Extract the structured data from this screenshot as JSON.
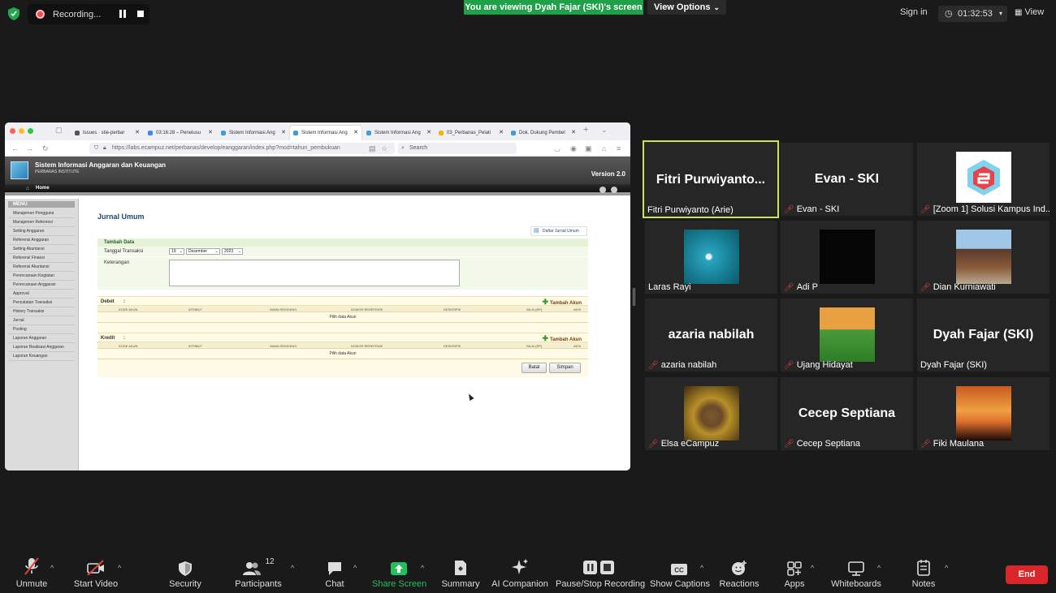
{
  "topbar": {
    "recording_label": "Recording...",
    "banner": "You are viewing Dyah Fajar (SKI)'s screen",
    "view_options": "View Options",
    "sign_in": "Sign in",
    "timer": "01:32:53",
    "view": "View",
    "colors": {
      "banner": "#21a04a",
      "record": "#ef4f4f"
    }
  },
  "browser": {
    "tabs": [
      {
        "label": "Issues · stie-perbar"
      },
      {
        "label": "03:16:28 – Penelusu"
      },
      {
        "label": "Sistem Informasi Ang"
      },
      {
        "label": "Sistem Informasi Ang"
      },
      {
        "label": "Sistem Informasi Ang"
      },
      {
        "label": "03_Perbanas_Pelati"
      },
      {
        "label": "Dok. Dukung Pembel"
      }
    ],
    "url": "https://labs.ecampuz.net/perbanas/develop/eanggaran/index.php?mod=tahun_pembukuan",
    "search_placeholder": "Search"
  },
  "app": {
    "title": "Sistem Informasi Anggaran dan Keuangan",
    "subtitle": "PERBANAS INSTITUTE",
    "version": "Version 2.0",
    "home": "Home",
    "menu_title": "MENU",
    "menu": [
      "Manajemen Pengguna",
      "Manajemen Referensi",
      "Setting Anggaran",
      "Referensi Anggaran",
      "Setting Akuntansi",
      "Referensi Finansi",
      "Referensi Akuntansi",
      "Perencanaan Kegiatan",
      "Perencanaan Anggaran",
      "Approval",
      "Pencatatan Transaksi",
      "History Transaksi",
      "Jurnal",
      "Posting",
      "Laporan Anggaran",
      "Laporan Realisasi Anggaran",
      "Laporan Keuangan"
    ],
    "page_title": "Jurnal Umum",
    "daftar_link": "Daftar Jurnal Umum",
    "form": {
      "section_title": "Tambah Data",
      "date_label": "Tanggal Transaksi",
      "day": "19",
      "month": "Desember",
      "year": "2023",
      "notes_label": "Keterangan"
    },
    "debet": {
      "label": "Debet",
      "colon": ":",
      "add": "Tambah Akun",
      "columns": [
        "KODE AKUN",
        "ATRIBUT",
        "NAMA REKENING",
        "NOMOR REREFENSI",
        "DESKRIPSI",
        "NILAI (RP)",
        "AKSI"
      ],
      "empty": "Pilih data Akun"
    },
    "kredit": {
      "label": "Kredit",
      "colon": ":",
      "add": "Tambah Akun",
      "columns": [
        "KODE AKUN",
        "ATRIBUT",
        "NAMA REKENING",
        "NOMOR REREFENSI",
        "DESKRIPSI",
        "NILAI (RP)",
        "AKSI"
      ],
      "empty": "Pilih data Akun"
    },
    "buttons": {
      "cancel": "Batal",
      "save": "Simpan"
    }
  },
  "participants": [
    {
      "big": "Fitri  Purwiyanto...",
      "name": "Fitri Purwiyanto (Arie)",
      "muted": false,
      "active": true
    },
    {
      "big": "Evan - SKI",
      "name": "Evan - SKI",
      "muted": true
    },
    {
      "big": "",
      "name": "[Zoom 1] Solusi Kampus Ind...",
      "muted": true
    },
    {
      "big": "",
      "name": "Laras Rayi",
      "muted": false
    },
    {
      "big": "",
      "name": "Adi P",
      "muted": true
    },
    {
      "big": "",
      "name": "Dian Kurniawati",
      "muted": true
    },
    {
      "big": "azaria nabilah",
      "name": "azaria nabilah",
      "muted": true
    },
    {
      "big": "",
      "name": "Ujang Hidayat",
      "muted": true
    },
    {
      "big": "Dyah Fajar (SKI)",
      "name": "Dyah Fajar (SKI)",
      "muted": false
    },
    {
      "big": "",
      "name": "Elsa eCampuz",
      "muted": true
    },
    {
      "big": "Cecep Septiana",
      "name": "Cecep Septiana",
      "muted": true
    },
    {
      "big": "",
      "name": "Fiki Maulana",
      "muted": true
    }
  ],
  "toolbar": {
    "unmute": "Unmute",
    "start_video": "Start Video",
    "security": "Security",
    "participants": "Participants",
    "participant_count": "12",
    "chat": "Chat",
    "share_screen": "Share Screen",
    "summary": "Summary",
    "ai_companion": "AI Companion",
    "pause_recording": "Pause/Stop Recording",
    "captions": "Show Captions",
    "reactions": "Reactions",
    "apps": "Apps",
    "whiteboards": "Whiteboards",
    "notes": "Notes",
    "end": "End",
    "colors": {
      "share": "#21c05a",
      "end": "#d9262c"
    }
  }
}
